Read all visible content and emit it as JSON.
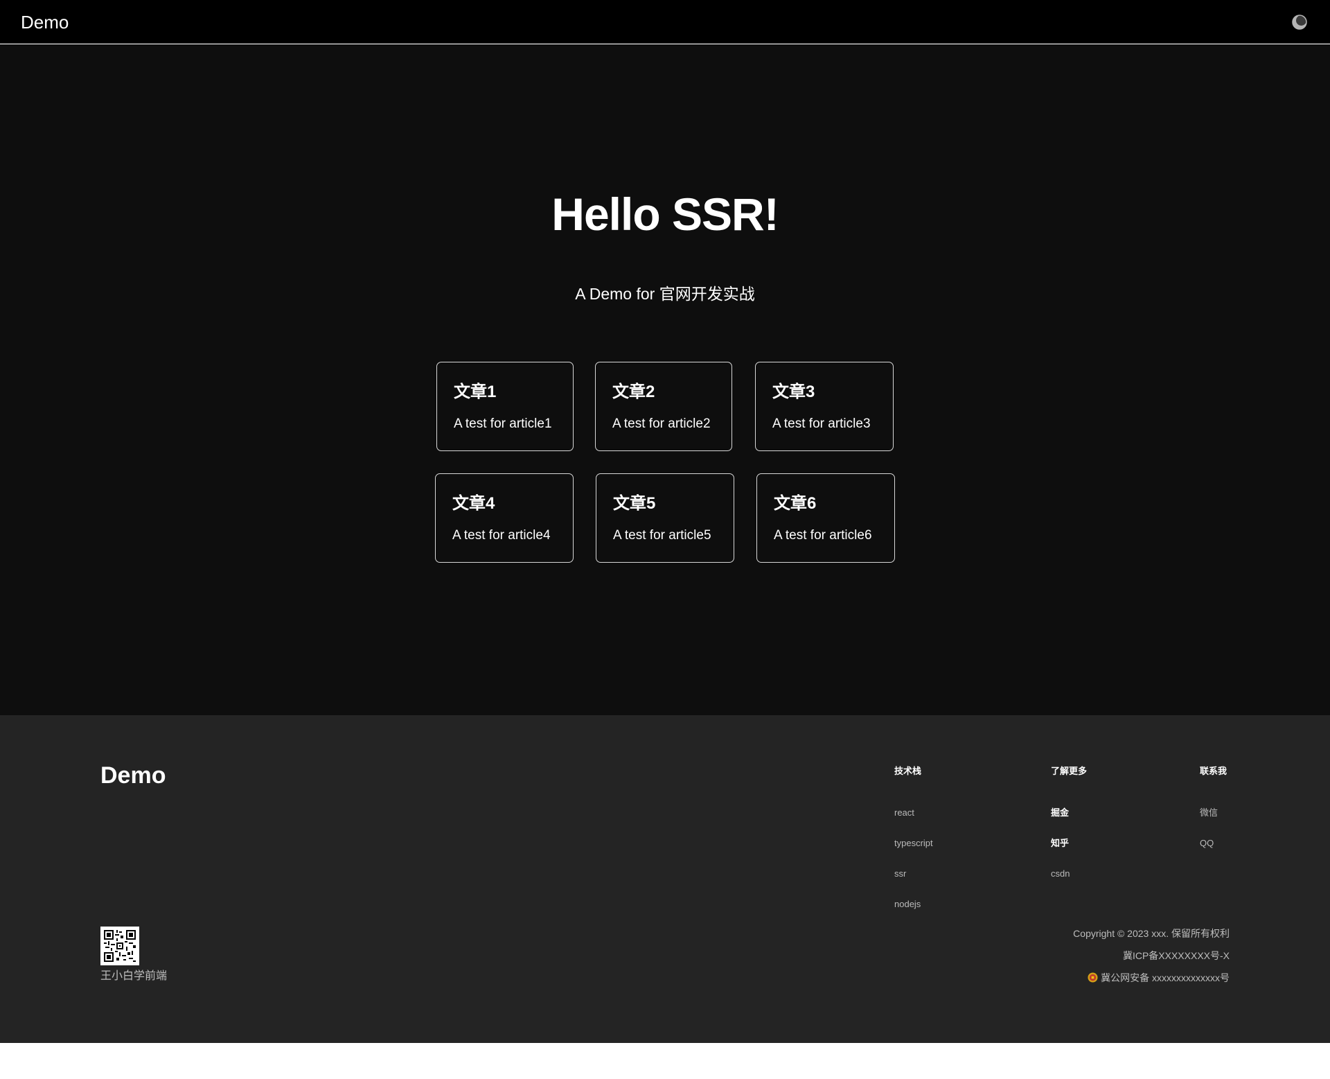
{
  "header": {
    "logo": "Demo",
    "theme_toggle_icon": "theme-toggle-icon"
  },
  "hero": {
    "title": "Hello SSR!",
    "subtitle": "A Demo for 官网开发实战"
  },
  "articles": [
    {
      "title": "文章1",
      "desc": "A test for article1"
    },
    {
      "title": "文章2",
      "desc": "A test for article2"
    },
    {
      "title": "文章3",
      "desc": "A test for article3"
    },
    {
      "title": "文章4",
      "desc": "A test for article4"
    },
    {
      "title": "文章5",
      "desc": "A test for article5"
    },
    {
      "title": "文章6",
      "desc": "A test for article6"
    }
  ],
  "footer": {
    "logo": "Demo",
    "columns": [
      {
        "title": "技术栈",
        "links": [
          "react",
          "typescript",
          "ssr",
          "nodejs"
        ]
      },
      {
        "title": "了解更多",
        "links": [
          "掘金",
          "知乎",
          "csdn"
        ]
      },
      {
        "title": "联系我",
        "links": [
          "微信",
          "QQ"
        ]
      }
    ],
    "qr_label": "王小白学前端",
    "copyright": "Copyright © 2023 xxx. 保留所有权利",
    "icp": "冀ICP备XXXXXXXX号-X",
    "police": "冀公网安备 xxxxxxxxxxxxxx号"
  },
  "colors": {
    "header_bg": "#000000",
    "main_bg": "#0e0e0e",
    "footer_bg": "#242424",
    "text": "#ffffff",
    "muted": "#bbbbbb"
  }
}
